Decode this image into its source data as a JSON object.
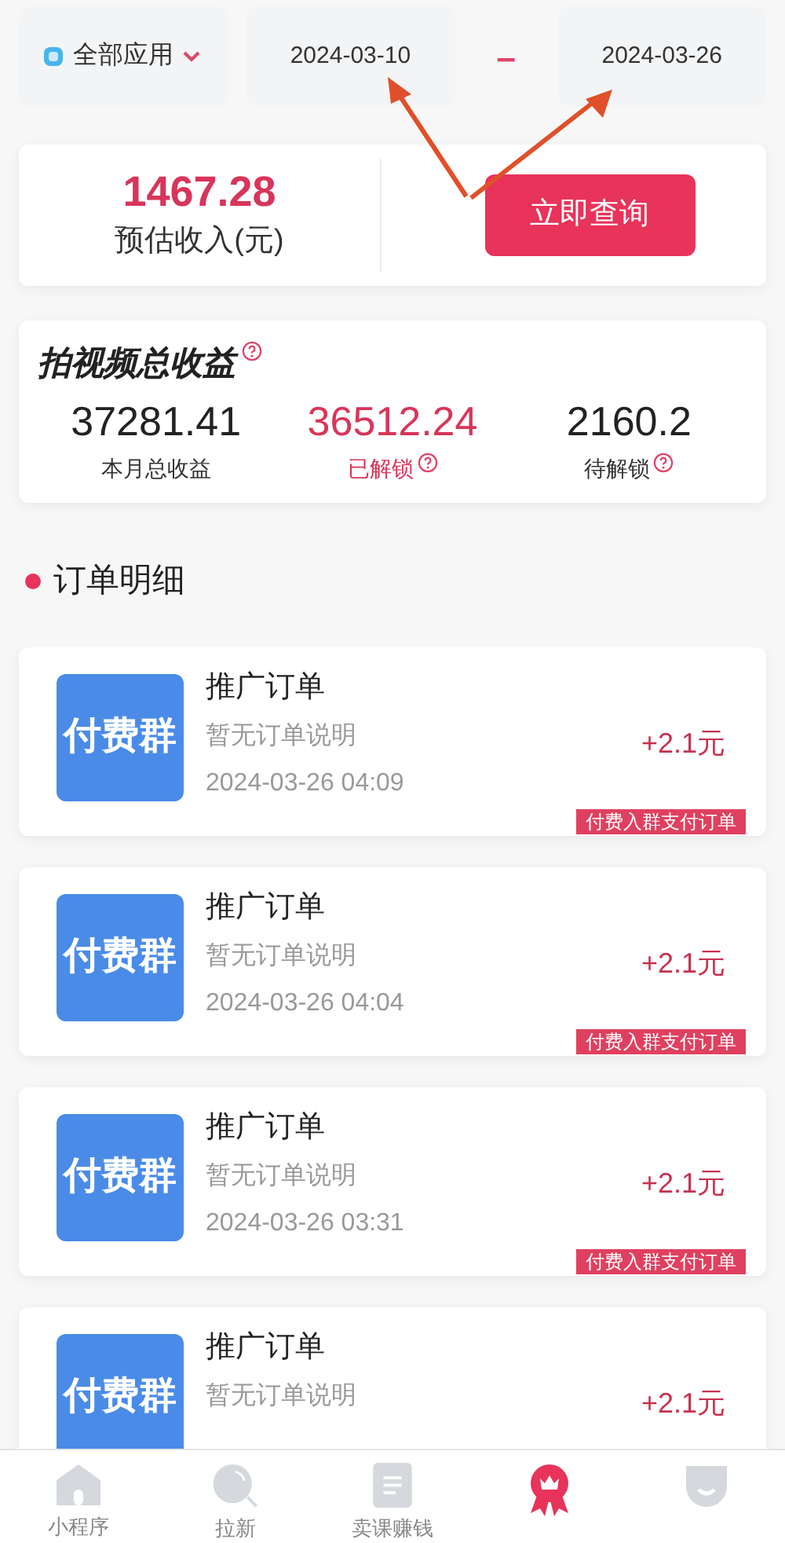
{
  "filter": {
    "app_select": "全部应用",
    "start_date": "2024-03-10",
    "separator": "–",
    "end_date": "2024-03-26"
  },
  "estimate": {
    "amount": "1467.28",
    "label": "预估收入(元)",
    "button": "立即查询"
  },
  "summary": {
    "title": "拍视频总收益",
    "stats": [
      {
        "value": "37281.41",
        "label": "本月总收益",
        "highlight": false,
        "help": false
      },
      {
        "value": "36512.24",
        "label": "已解锁",
        "highlight": true,
        "help": true
      },
      {
        "value": "2160.2",
        "label": "待解锁",
        "highlight": false,
        "help": true
      }
    ]
  },
  "orders_title": "订单明细",
  "orders": [
    {
      "thumb": "付费群",
      "title": "推广订单",
      "desc": "暂无订单说明",
      "time": "2024-03-26 04:09",
      "amount": "+2.1元",
      "tag": "付费入群支付订单"
    },
    {
      "thumb": "付费群",
      "title": "推广订单",
      "desc": "暂无订单说明",
      "time": "2024-03-26 04:04",
      "amount": "+2.1元",
      "tag": "付费入群支付订单"
    },
    {
      "thumb": "付费群",
      "title": "推广订单",
      "desc": "暂无订单说明",
      "time": "2024-03-26 03:31",
      "amount": "+2.1元",
      "tag": "付费入群支付订单"
    },
    {
      "thumb": "付费群",
      "title": "推广订单",
      "desc": "暂无订单说明",
      "amount": "+2.1元"
    }
  ],
  "tabbar": [
    {
      "kind": "home",
      "label": "小程序",
      "selected": false
    },
    {
      "kind": "search",
      "label": "拉新",
      "selected": false
    },
    {
      "kind": "doc",
      "label": "卖课赚钱",
      "selected": false
    },
    {
      "kind": "badge",
      "selected": true
    },
    {
      "kind": "face",
      "selected": false
    }
  ]
}
